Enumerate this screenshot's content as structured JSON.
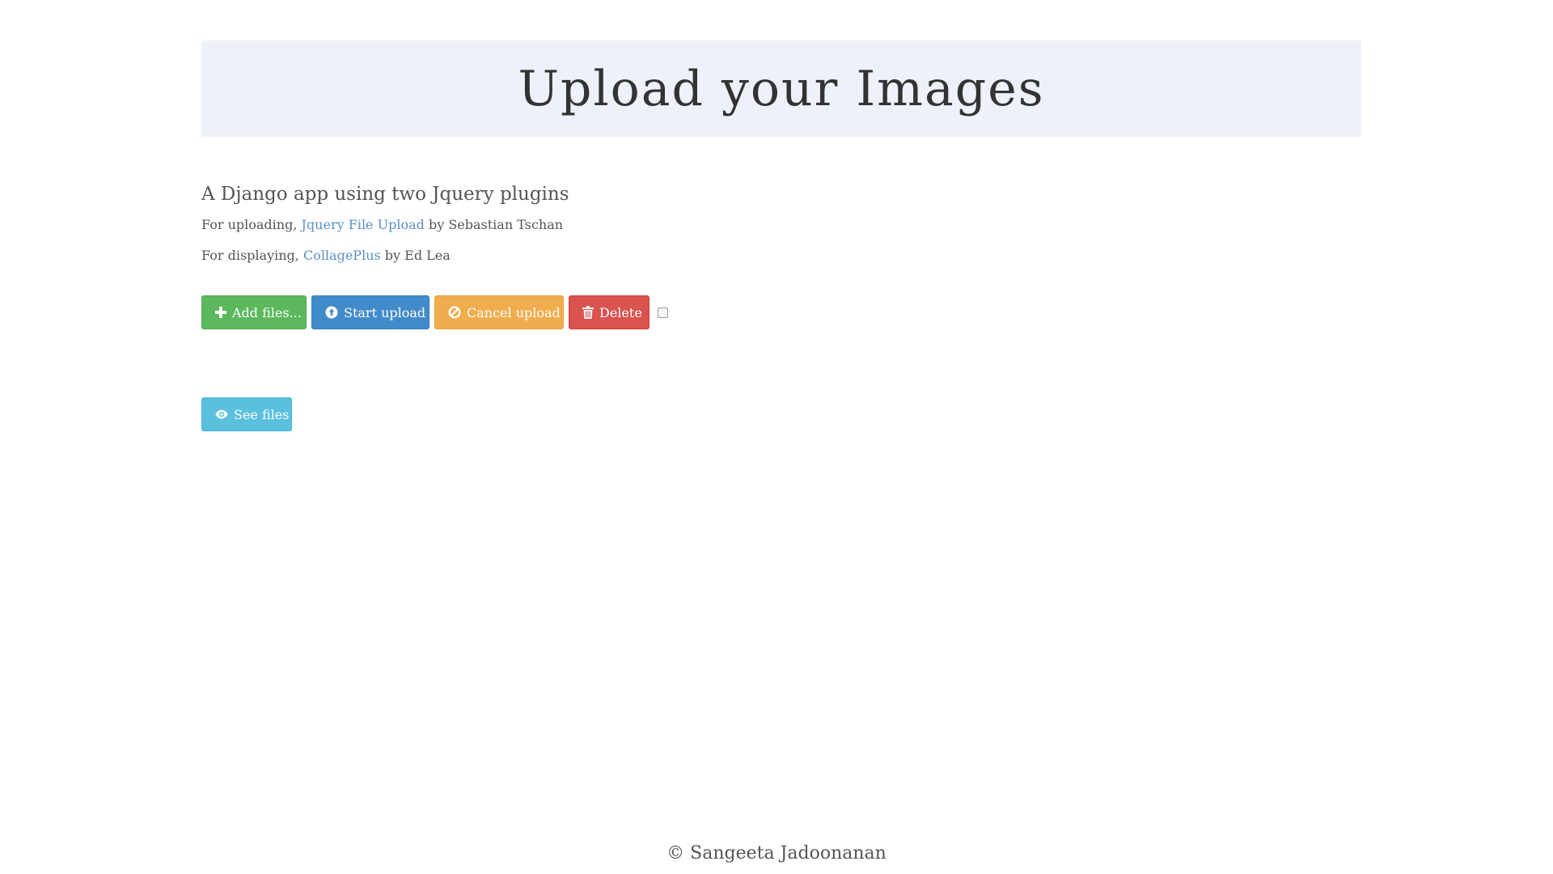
{
  "header": {
    "title": "Upload your Images"
  },
  "intro": {
    "subtitle": "A Django app using two Jquery plugins",
    "uploading_prefix": "For uploading, ",
    "uploading_link": "Jquery File Upload",
    "uploading_suffix": " by Sebastian Tschan",
    "displaying_prefix": "For displaying, ",
    "displaying_link": "CollagePlus",
    "displaying_suffix": " by Ed Lea"
  },
  "toolbar": {
    "add_label": "Add files...",
    "start_label": "Start upload",
    "cancel_label": "Cancel upload",
    "delete_label": "Delete",
    "add_icon": "plus-icon",
    "start_icon": "circle-arrow-up-icon",
    "cancel_icon": "ban-circle-icon",
    "delete_icon": "trash-icon"
  },
  "see_files": {
    "label": "See files",
    "icon": "eye-icon"
  },
  "footer": {
    "text": "© Sangeeta Jadoonanan"
  },
  "colors": {
    "jumbotron_bg": "#eef1fa",
    "success": "#5cb85c",
    "primary": "#428bca",
    "warning": "#f0ad4e",
    "danger": "#d9534f",
    "info": "#5bc0de",
    "link": "#5b8fc8"
  }
}
